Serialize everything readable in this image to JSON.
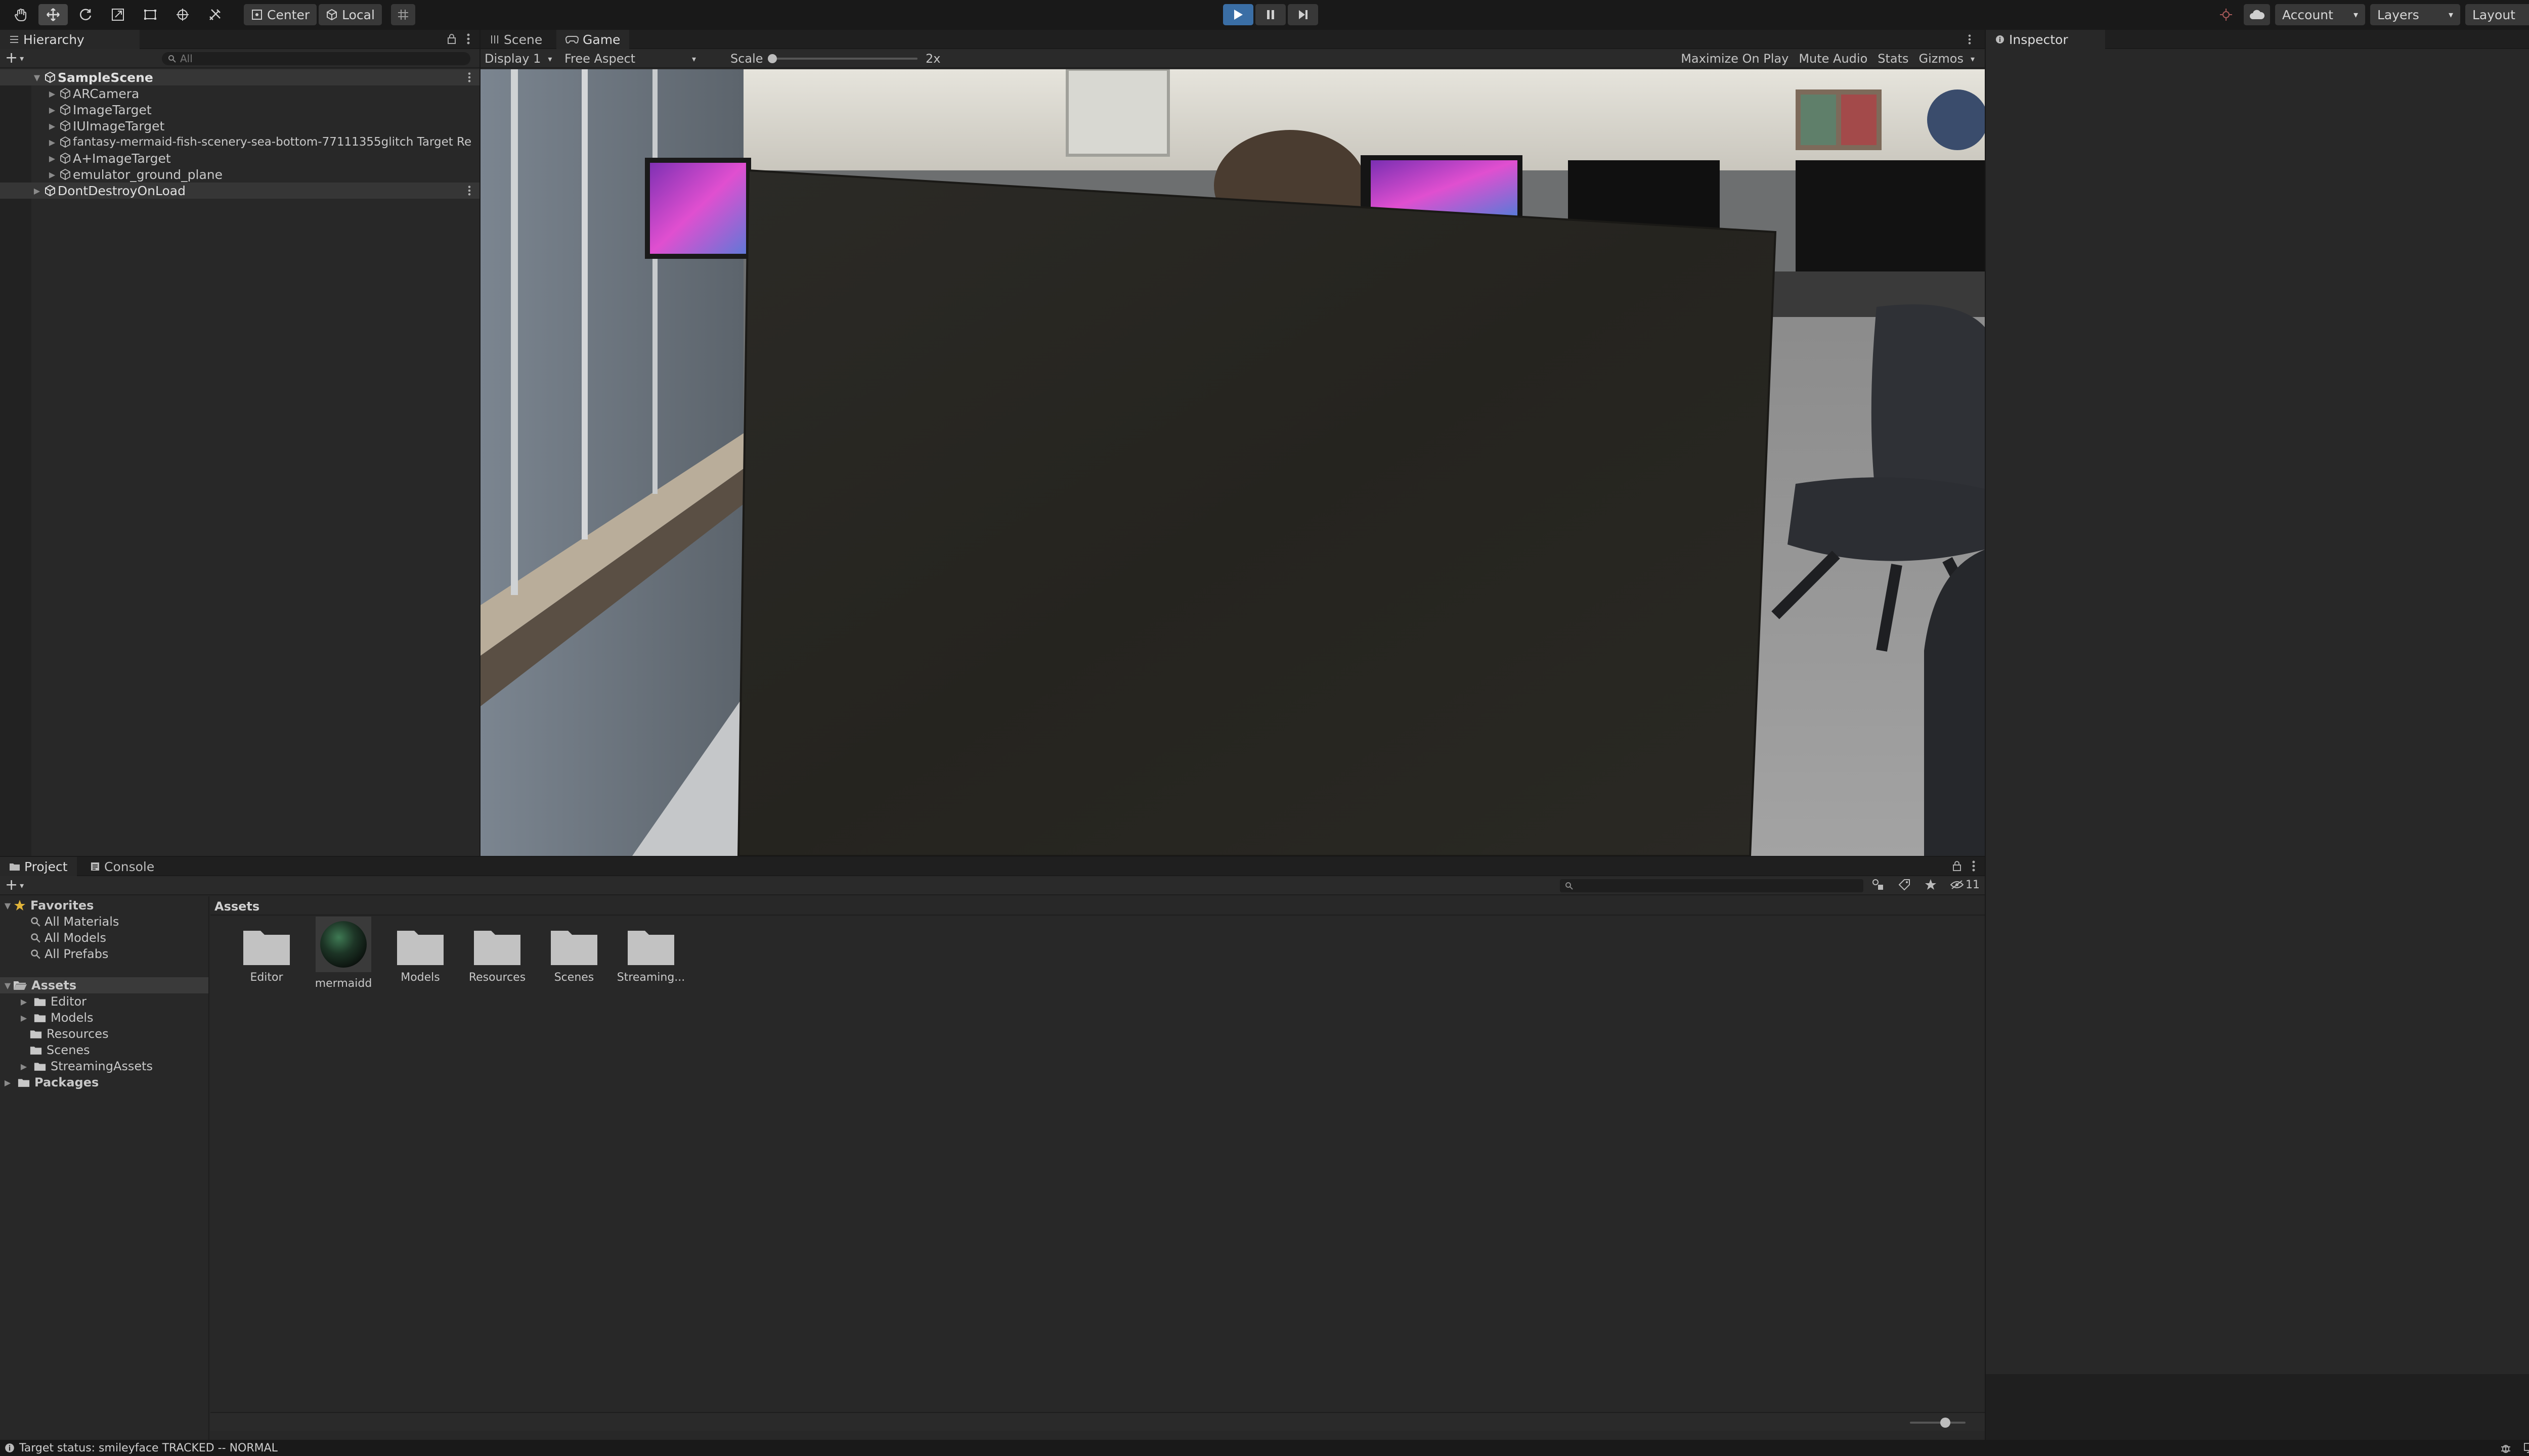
{
  "toolbar": {
    "tools": [
      "hand-tool",
      "move-tool",
      "rotate-tool",
      "scale-tool",
      "rect-tool",
      "transform-tool",
      "custom-tool"
    ],
    "pivot_label": "Center",
    "space_label": "Local",
    "account_label": "Account",
    "layers_label": "Layers",
    "layout_label": "Layout",
    "colors": {
      "play_active": "#3a6ea5",
      "toolbar_bg": "#191919"
    }
  },
  "hierarchy": {
    "tab_label": "Hierarchy",
    "search_placeholder": "All",
    "scene": "SampleScene",
    "items": [
      {
        "label": "ARCamera"
      },
      {
        "label": "ImageTarget"
      },
      {
        "label": "IUImageTarget"
      },
      {
        "label": "fantasy-mermaid-fish-scenery-sea-bottom-77111355glitch Target Re"
      },
      {
        "label": "A+ImageTarget"
      },
      {
        "label": "emulator_ground_plane"
      }
    ],
    "dont_destroy": "DontDestroyOnLoad"
  },
  "game": {
    "tabs": [
      "Scene",
      "Game"
    ],
    "display_label": "Display 1",
    "aspect_label": "Free Aspect",
    "scale_label": "Scale",
    "scale_value": "2x",
    "maximize_label": "Maximize On Play",
    "mute_label": "Mute Audio",
    "stats_label": "Stats",
    "gizmos_label": "Gizmos"
  },
  "inspector": {
    "tab_label": "Inspector"
  },
  "project": {
    "tabs": [
      "Project",
      "Console"
    ],
    "favorites_label": "Favorites",
    "favorites": [
      "All Materials",
      "All Models",
      "All Prefabs"
    ],
    "assets_label": "Assets",
    "asset_folders": [
      "Editor",
      "Models",
      "Resources",
      "Scenes",
      "StreamingAssets"
    ],
    "packages_label": "Packages",
    "breadcrumb": "Assets",
    "hidden_count": "11",
    "grid": [
      {
        "label": "Editor",
        "kind": "folder"
      },
      {
        "label": "mermaidd",
        "kind": "material"
      },
      {
        "label": "Models",
        "kind": "folder"
      },
      {
        "label": "Resources",
        "kind": "folder"
      },
      {
        "label": "Scenes",
        "kind": "folder"
      },
      {
        "label": "Streaming...",
        "kind": "folder"
      }
    ]
  },
  "status": {
    "text": "Target status: smileyface TRACKED -- NORMAL"
  }
}
